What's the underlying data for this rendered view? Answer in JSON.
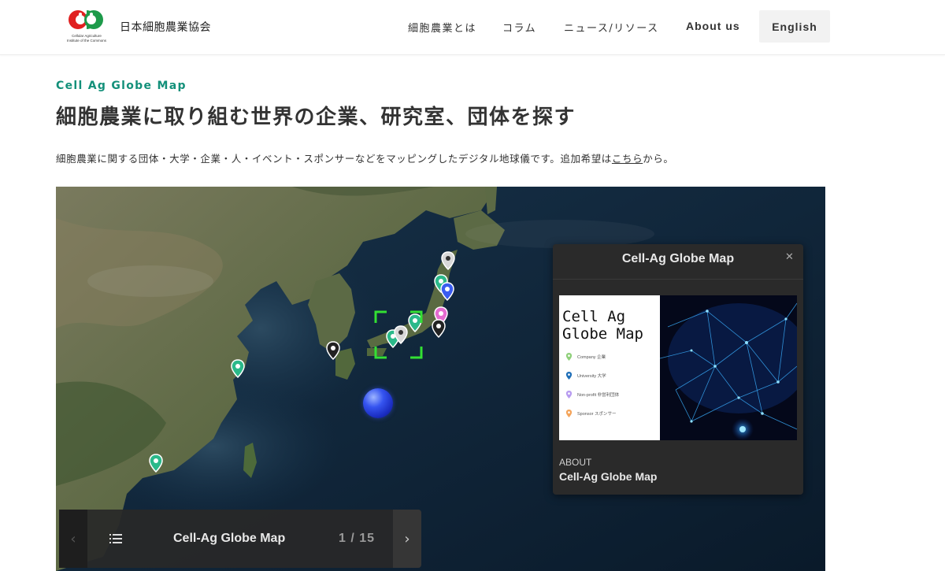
{
  "header": {
    "logo_sub_line1": "Cellular Agriculture",
    "logo_sub_line2": "Institute of the Commons",
    "site_name": "日本細胞農業協会",
    "nav": {
      "what_is": "細胞農業とは",
      "column": "コラム",
      "news": "ニュース/リソース",
      "about": "About us"
    },
    "lang_button": "English"
  },
  "intro": {
    "eyebrow": "Cell Ag Globe Map",
    "heading": "細胞農業に取り組む世界の企業、研究室、団体を探す",
    "lead_text": "細胞農業に関する団体・大学・企業・人・イベント・スポンサーなどをマッピングしたデジタル地球儀です。追加希望は",
    "lead_link": "こちら",
    "lead_suffix": "から。"
  },
  "popup": {
    "title": "Cell-Ag Globe Map",
    "close_icon": "✕",
    "card_title_line1": "Cell Ag",
    "card_title_line2": "Globe Map",
    "legend": [
      {
        "label": "Company 企業",
        "color": "#8fd07a"
      },
      {
        "label": "University 大学",
        "color": "#1f6fb8"
      },
      {
        "label": "Non-profit 非営利団体",
        "color": "#b79bf0"
      },
      {
        "label": "Sponsor スポンサー",
        "color": "#f4a45a"
      }
    ],
    "about_label": "ABOUT",
    "about_title": "Cell-Ag Globe Map"
  },
  "controls": {
    "prev_icon": "‹",
    "next_icon": "›",
    "title": "Cell-Ag Globe Map",
    "page_current": "1",
    "page_total": "15",
    "page_text": "1 / 15"
  },
  "colors": {
    "accent": "#13907a",
    "pin_green": "#2bb98a",
    "pin_blue": "#3a5cf0",
    "pin_pink": "#e46ad0",
    "pin_black": "#222222",
    "pin_white": "#d8d8d8",
    "focus": "#33e033"
  }
}
